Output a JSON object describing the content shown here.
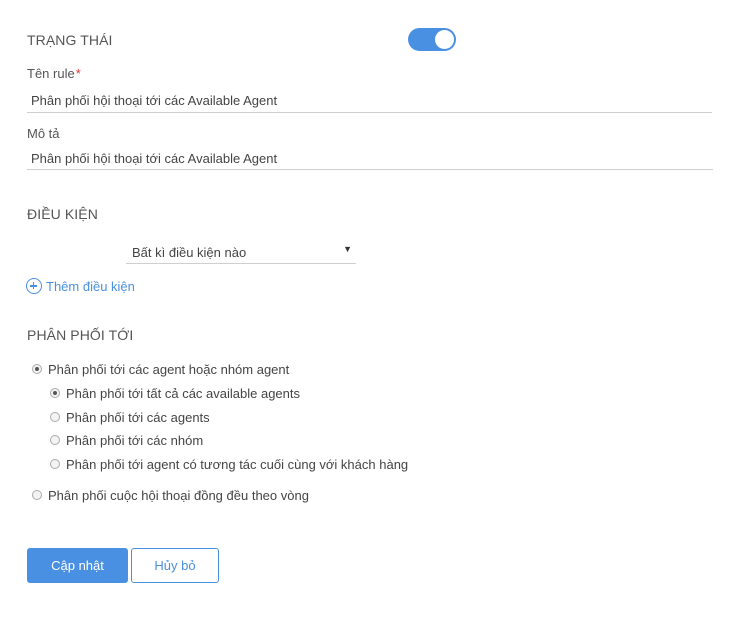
{
  "status": {
    "label": "TRẠNG THÁI",
    "enabled": true
  },
  "rule_name": {
    "label": "Tên rule",
    "required_mark": "*",
    "value": "Phân phối hội thoại tới các Available Agent"
  },
  "description": {
    "label": "Mô tả",
    "value": "Phân phối hội thoại tới các Available Agent"
  },
  "conditions": {
    "label": "ĐIỀU KIỆN",
    "selected": "Bất kì điều kiện nào",
    "caret": "▼",
    "add_label": "Thêm điều kiện"
  },
  "distribution": {
    "label": "PHÂN PHỐI TỚI",
    "options": [
      {
        "label": "Phân phối tới các agent hoặc nhóm agent",
        "checked": true
      },
      {
        "label": "Phân phối cuộc hội thoại đồng đều theo vòng",
        "checked": false
      }
    ],
    "sub_options": [
      {
        "label": "Phân phối tới tất cả các available agents",
        "checked": true
      },
      {
        "label": "Phân phối tới các agents",
        "checked": false
      },
      {
        "label": "Phân phối tới các nhóm",
        "checked": false
      },
      {
        "label": "Phân phối tới agent có tương tác cuối cùng với khách hàng",
        "checked": false
      }
    ]
  },
  "actions": {
    "update_label": "Cập nhật",
    "cancel_label": "Hủy bỏ"
  },
  "colors": {
    "accent": "#4a90e2",
    "required": "#e53935",
    "text": "#555555"
  }
}
